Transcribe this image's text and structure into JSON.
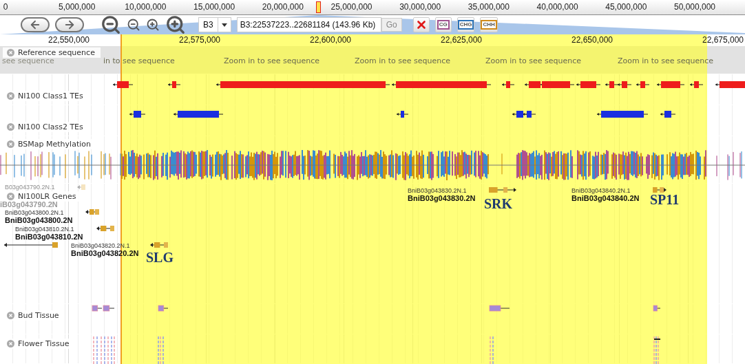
{
  "overview": {
    "ticks": [
      "0",
      "5,000,000",
      "10,000,000",
      "15,000,000",
      "20,000,000",
      "25,000,000",
      "30,000,000",
      "35,000,000",
      "40,000,000",
      "45,000,000",
      "50,000,000"
    ]
  },
  "toolbar": {
    "refseq": "B3",
    "location": "B3:22537223..22681184 (143.96 Kb)",
    "go": "Go",
    "track_buttons": [
      {
        "kind": "clear"
      },
      {
        "kind": "context",
        "label": "CG",
        "color": "#a0508f"
      },
      {
        "kind": "context",
        "label": "CHG",
        "color": "#2a72b8"
      },
      {
        "kind": "context",
        "label": "CHH",
        "color": "#d08a1a"
      }
    ]
  },
  "ruler": {
    "ticks": [
      "22,550,000",
      "22,575,000",
      "22,600,000",
      "22,625,000",
      "22,650,000",
      "22,675,000"
    ]
  },
  "highlight": {
    "on": true
  },
  "tracks": [
    {
      "kind": "sequence",
      "label": "Reference sequence",
      "messages": [
        "see sequence",
        "in to see sequence",
        "Zoom in to see sequence",
        "Zoom in to see sequence",
        "Zoom in to see sequence",
        "Zoom in to see sequence"
      ]
    },
    {
      "kind": "te",
      "label": "NI100 Class1 TEs",
      "color": "#ee1c1c"
    },
    {
      "kind": "te",
      "label": "NI100 Class2 TEs",
      "color": "#1a2ee0"
    },
    {
      "kind": "methylation",
      "label": "BSMap Methylation"
    },
    {
      "kind": "genes",
      "label": "NI100LR Genes",
      "genes": [
        {
          "name": "B03g043790.2N.1",
          "symbol": "iB03g043790.2N"
        },
        {
          "name": "BniB03g043800.2N.1",
          "symbol": "BniB03g043800.2N"
        },
        {
          "name": "BniB03g043810.2N.1",
          "symbol": "BniB03g043810.2N"
        },
        {
          "name": "BniB03g043820.2N.1",
          "symbol": "BniB03g043820.2N",
          "annotation": "SLG"
        },
        {
          "name": "BniB03g043830.2N.1",
          "symbol": "BniB03g043830.2N",
          "annotation": "SRK"
        },
        {
          "name": "BniB03g043840.2N.1",
          "symbol": "BniB03g043840.2N",
          "annotation": "SP11"
        }
      ]
    },
    {
      "kind": "reads",
      "label": "Bud Tissue"
    },
    {
      "kind": "coverage",
      "label": "Flower Tissue"
    }
  ]
}
